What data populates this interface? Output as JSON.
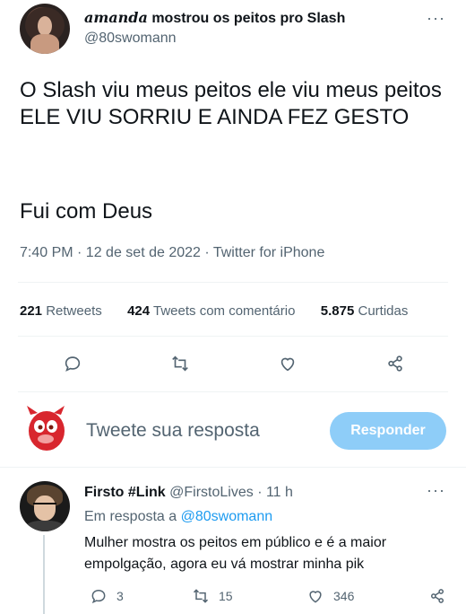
{
  "tweet": {
    "author_name_prefix": "amanda",
    "author_name_rest": "mostrou os peitos pro Slash",
    "handle": "@80swomann",
    "text": "O Slash viu meus peitos ele viu meus peitos ELE VIU SORRIU E AINDA FEZ GESTO",
    "text2": "Fui com Deus",
    "meta": "7:40 PM · 12 de set de 2022 · Twitter for iPhone",
    "more": "···"
  },
  "stats": {
    "retweets_count": "221",
    "retweets_label": "Retweets",
    "quotes_count": "424",
    "quotes_label": "Tweets com comentário",
    "likes_count": "5.875",
    "likes_label": "Curtidas"
  },
  "actions": {
    "icons": [
      "reply-icon",
      "retweet-icon",
      "like-icon",
      "share-icon"
    ]
  },
  "composer": {
    "placeholder": "Tweete sua resposta",
    "button": "Responder",
    "button_color": "#8ecdf8"
  },
  "reply": {
    "name": "Firsto #Link",
    "handle": "@FirstoLives",
    "time": "· 11 h",
    "replying_prefix": "Em resposta a",
    "replying_handle": "@80swomann",
    "text": "Mulher mostra os peitos em público e é a maior empolgação, agora eu vá mostrar minha pik",
    "replies": "3",
    "retweets": "15",
    "likes": "346",
    "more": "···"
  },
  "colors": {
    "accent": "#1d9bf0",
    "muted": "#536471",
    "text": "#0f1419"
  }
}
